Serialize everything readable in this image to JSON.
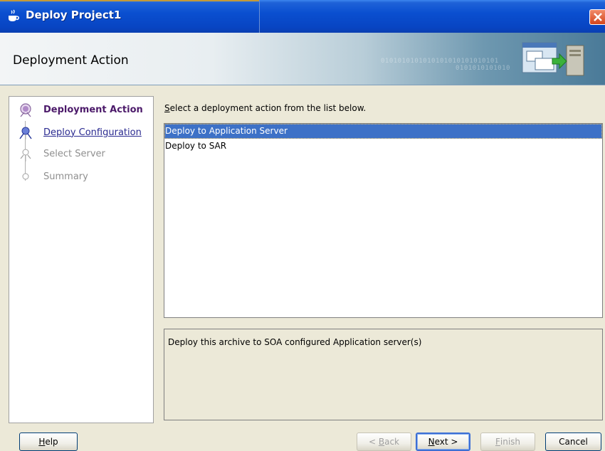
{
  "window": {
    "title": "Deploy Project1",
    "icons": {
      "app": "coffee-cup-icon",
      "close": "close-x-icon"
    }
  },
  "header": {
    "title": "Deployment Action",
    "binary_line1": "0101010101010101010101010101",
    "binary_line2": "0101010101010",
    "graphic": "deploy-to-server-icon"
  },
  "nav": {
    "items": [
      {
        "label": "Deployment Action",
        "state": "active"
      },
      {
        "label": "Deploy Configuration",
        "state": "link"
      },
      {
        "label": "Select Server",
        "state": "disabled"
      },
      {
        "label": "Summary",
        "state": "disabled"
      }
    ]
  },
  "main": {
    "instruction_prefix": "S",
    "instruction_rest": "elect a deployment action from the list below.",
    "actions": [
      {
        "label": "Deploy to Application Server",
        "selected": true
      },
      {
        "label": "Deploy to SAR",
        "selected": false
      }
    ],
    "description": "Deploy this archive to SOA configured Application server(s)"
  },
  "buttons": {
    "help": {
      "mnemonic": "H",
      "rest": "elp"
    },
    "back": {
      "pre": "< ",
      "mnemonic": "B",
      "rest": "ack"
    },
    "next": {
      "mnemonic": "N",
      "rest": "ext >"
    },
    "finish": {
      "mnemonic": "F",
      "rest": "inish"
    },
    "cancel": {
      "label": "Cancel"
    }
  },
  "colors": {
    "titlebar": "#0a4fd0",
    "selection": "#3d71c7",
    "nav_active": "#4c1a6a",
    "nav_link": "#2a2a90"
  }
}
